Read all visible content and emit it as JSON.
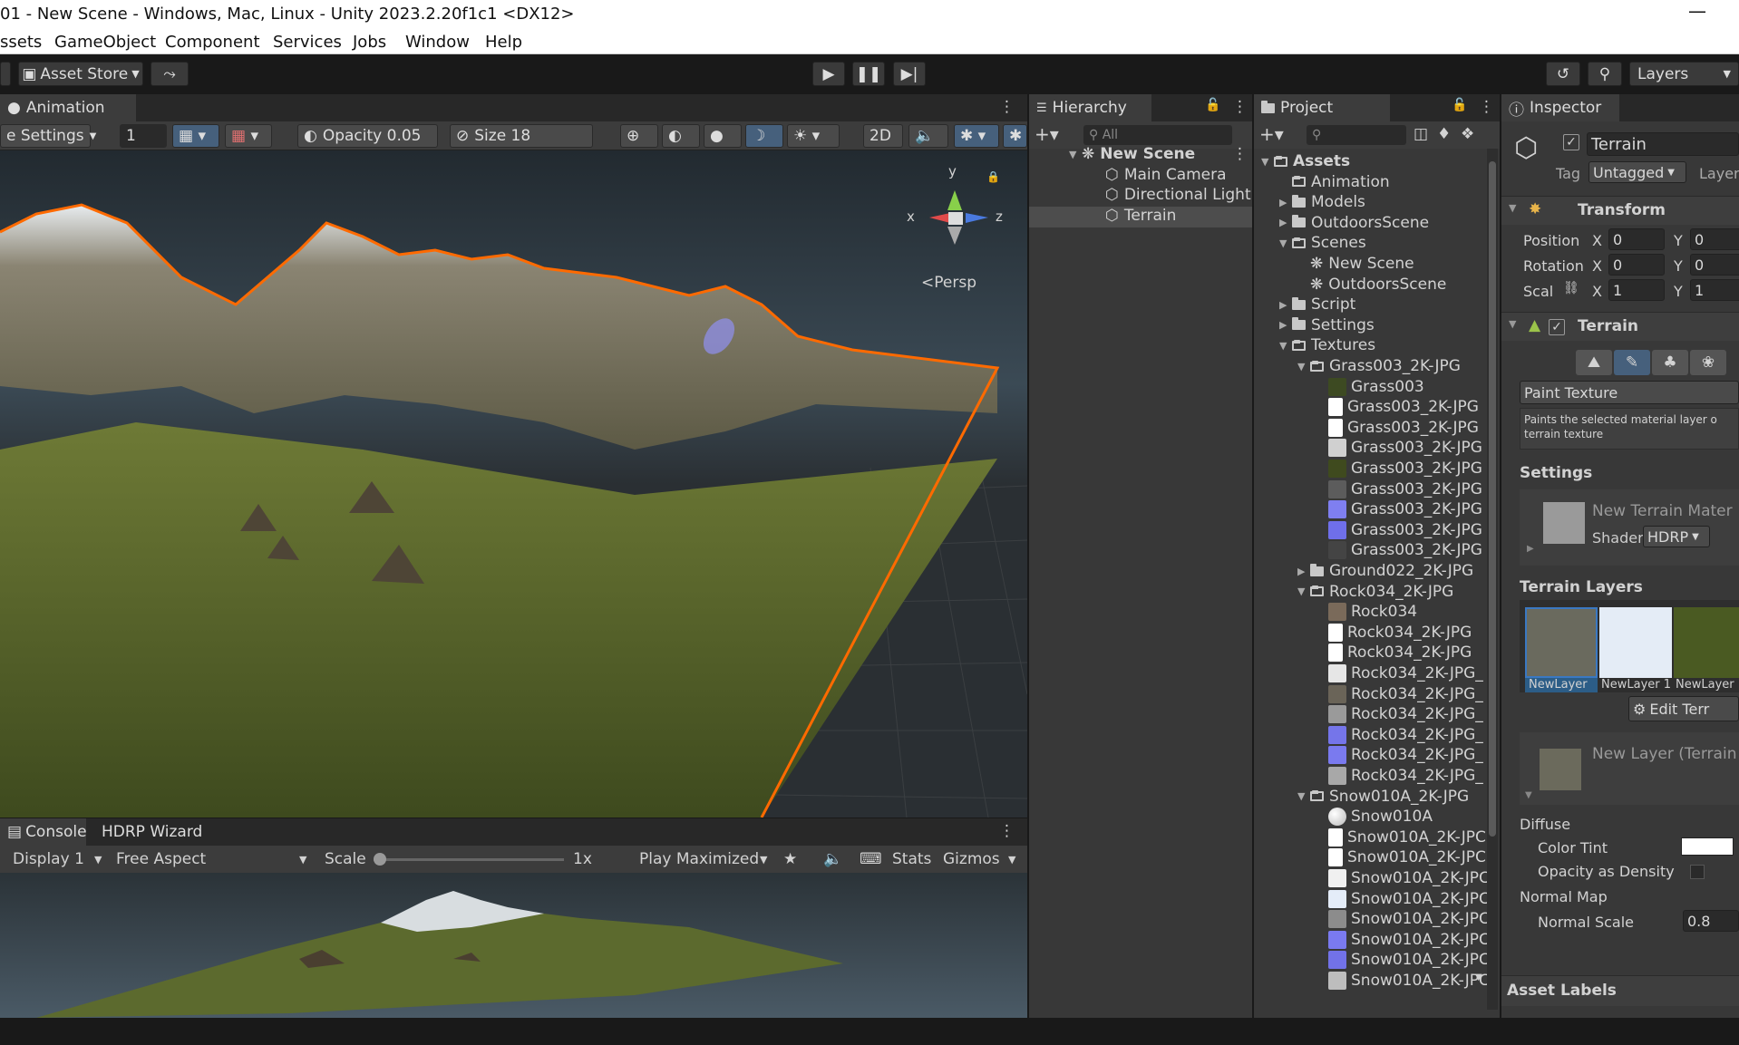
{
  "window": {
    "title": "01 - New Scene - Windows, Mac, Linux - Unity 2023.2.20f1c1 <DX12>",
    "minimize": "—"
  },
  "menu": [
    "ssets",
    "GameObject",
    "Component",
    "Services",
    "Jobs",
    "Window",
    "Help"
  ],
  "toolbar": {
    "asset_store": "Asset Store",
    "layers": "Layers",
    "icons": [
      "play-icon",
      "pause-icon",
      "step-icon",
      "history-icon",
      "search-icon"
    ]
  },
  "scene": {
    "tab": "Animation",
    "settings_label": "e Settings",
    "number_field": "1",
    "opacity": "Opacity 0.05",
    "size": "Size 18",
    "mode_2d": "2D",
    "persp": "<Persp",
    "gizmo_axes": {
      "y": "y",
      "x": "x",
      "z": "z"
    }
  },
  "game": {
    "tabs": [
      "Console",
      "HDRP Wizard"
    ],
    "display": "Display 1",
    "aspect": "Free Aspect",
    "scale_label": "Scale",
    "scale_value": "1x",
    "play_mode": "Play Maximized",
    "stats": "Stats",
    "gizmos": "Gizmos",
    "scale_slider": 0.0
  },
  "hierarchy": {
    "tab": "Hierarchy",
    "search_placeholder": "All",
    "items": [
      {
        "label": "New Scene",
        "bold": true
      },
      {
        "label": "Main Camera"
      },
      {
        "label": "Directional Light"
      },
      {
        "label": "Terrain",
        "selected": true
      }
    ]
  },
  "project": {
    "tab": "Project",
    "items": [
      {
        "label": "Assets",
        "kind": "folder-open",
        "bold": true
      },
      {
        "label": "Animation",
        "kind": "folder-empty"
      },
      {
        "label": "Models",
        "kind": "folder"
      },
      {
        "label": "OutdoorsScene",
        "kind": "folder"
      },
      {
        "label": "Scenes",
        "kind": "folder-open"
      },
      {
        "label": "New Scene",
        "kind": "scene"
      },
      {
        "label": "OutdoorsScene",
        "kind": "scene"
      },
      {
        "label": "Script",
        "kind": "folder"
      },
      {
        "label": "Settings",
        "kind": "folder"
      },
      {
        "label": "Textures",
        "kind": "folder-open"
      },
      {
        "label": "Grass003_2K-JPG",
        "kind": "folder-open"
      },
      {
        "label": "Grass003",
        "kind": "swatch",
        "color": "#3d4a22"
      },
      {
        "label": "Grass003_2K-JPG",
        "kind": "file"
      },
      {
        "label": "Grass003_2K-JPG",
        "kind": "file"
      },
      {
        "label": "Grass003_2K-JPG",
        "kind": "swatch",
        "color": "#d0d0d0"
      },
      {
        "label": "Grass003_2K-JPG",
        "kind": "swatch",
        "color": "#3f4a1e"
      },
      {
        "label": "Grass003_2K-JPG",
        "kind": "swatch",
        "color": "#5c5c5c"
      },
      {
        "label": "Grass003_2K-JPG",
        "kind": "swatch",
        "color": "#7f7ff0"
      },
      {
        "label": "Grass003_2K-JPG",
        "kind": "swatch",
        "color": "#6f6fea"
      },
      {
        "label": "Grass003_2K-JPG",
        "kind": "swatch",
        "color": "#444444"
      },
      {
        "label": "Ground022_2K-JPG",
        "kind": "folder"
      },
      {
        "label": "Rock034_2K-JPG",
        "kind": "folder-open"
      },
      {
        "label": "Rock034",
        "kind": "swatch",
        "color": "#7a6a5a"
      },
      {
        "label": "Rock034_2K-JPG",
        "kind": "file"
      },
      {
        "label": "Rock034_2K-JPG",
        "kind": "file"
      },
      {
        "label": "Rock034_2K-JPG_",
        "kind": "swatch",
        "color": "#e6e6e6"
      },
      {
        "label": "Rock034_2K-JPG_",
        "kind": "swatch",
        "color": "#6a6458"
      },
      {
        "label": "Rock034_2K-JPG_",
        "kind": "swatch",
        "color": "#9a9a9a"
      },
      {
        "label": "Rock034_2K-JPG_",
        "kind": "swatch",
        "color": "#7575ea"
      },
      {
        "label": "Rock034_2K-JPG_",
        "kind": "swatch",
        "color": "#7a7aef"
      },
      {
        "label": "Rock034_2K-JPG_",
        "kind": "swatch",
        "color": "#a8a8a8"
      },
      {
        "label": "Snow010A_2K-JPG",
        "kind": "folder-open"
      },
      {
        "label": "Snow010A",
        "kind": "sphere"
      },
      {
        "label": "Snow010A_2K-JPC",
        "kind": "file"
      },
      {
        "label": "Snow010A_2K-JPC",
        "kind": "file"
      },
      {
        "label": "Snow010A_2K-JPC",
        "kind": "swatch",
        "color": "#f0f0f0"
      },
      {
        "label": "Snow010A_2K-JPC",
        "kind": "swatch",
        "color": "#e4ecf8"
      },
      {
        "label": "Snow010A_2K-JPC",
        "kind": "swatch",
        "color": "#8c8c8c"
      },
      {
        "label": "Snow010A_2K-JPC",
        "kind": "swatch",
        "color": "#7a7af0"
      },
      {
        "label": "Snow010A_2K-JPC",
        "kind": "swatch",
        "color": "#7272e8"
      },
      {
        "label": "Snow010A_2K-JPC",
        "kind": "swatch",
        "color": "#bdbdbd"
      }
    ]
  },
  "inspector": {
    "tab": "Inspector",
    "object_name": "Terrain",
    "tag_label": "Tag",
    "tag_value": "Untagged",
    "layer_label": "Layer",
    "transform": {
      "title": "Transform",
      "position_label": "Position",
      "rotation_label": "Rotation",
      "scale_label": "Scal",
      "x": "X",
      "y": "Y",
      "position_x": "0",
      "position_y": "0",
      "rotation_x": "0",
      "rotation_y": "0",
      "scale_x": "1",
      "scale_y": "1"
    },
    "terrain": {
      "title": "Terrain",
      "paint_texture": "Paint Texture",
      "description": "Paints the selected material layer o terrain texture",
      "settings": "Settings",
      "material": "New Terrain Mater",
      "shader_label": "Shader",
      "shader_value": "HDRP",
      "terrain_layers": "Terrain Layers",
      "layers": [
        "NewLayer",
        "NewLayer 1",
        "NewLayer"
      ],
      "edit_button": "Edit Terr",
      "new_layer": "New Layer (Terrain",
      "diffuse": "Diffuse",
      "color_tint": "Color Tint",
      "opacity_density": "Opacity as Density",
      "normal_map": "Normal Map",
      "normal_scale_label": "Normal Scale",
      "normal_scale_value": "0.8"
    },
    "asset_labels": "Asset Labels"
  },
  "colors": {
    "accent_orange": "#ff6a00",
    "selection_blue": "#2c5d87",
    "panel_bg": "#383838"
  }
}
